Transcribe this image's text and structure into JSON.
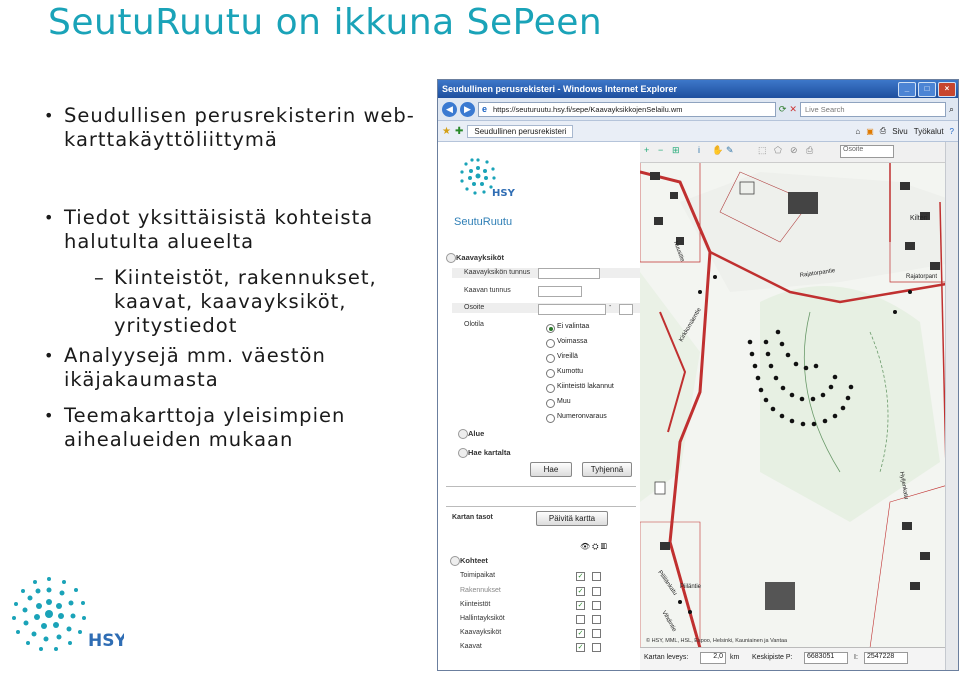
{
  "slide": {
    "title": "SeutuRuutu on ikkuna SePeen",
    "bullets": [
      "Seudullisen perusrekisterin web-karttakäyttöliittymä",
      "Tiedot yksittäisistä kohteista halutulta alueelta",
      "Analyysejä mm. väestön ikäjakaumasta",
      "Teemakarttoja yleisimpien aihealueiden mukaan"
    ],
    "subbullet": "Kiinteistöt, rakennukset, kaavat, kaavayksiköt, yritystiedot",
    "logo_text": "HSY"
  },
  "browser": {
    "title": "Seudullinen perusrekisteri - Windows Internet Explorer",
    "url": "https://seuturuutu.hsy.fi/sepe/KaavayksikkojenSelailu.wm",
    "search_placeholder": "Live Search",
    "tab_label": "Seudullinen perusrekisteri",
    "tools": [
      "Sivu",
      "Työkalut"
    ],
    "win_buttons": [
      "_",
      "□",
      "×"
    ]
  },
  "app": {
    "logo_text": "HSY",
    "product_name": "SeutuRuutu",
    "sections": {
      "kaavayksikot": "Kaavayksiköt",
      "alue": "Alue",
      "hae_kartalta": "Hae kartalta",
      "kartan_tasot": "Kartan tasot",
      "kohteet": "Kohteet"
    },
    "fields": {
      "kaavayksikon_tunnus": "Kaavayksikön tunnus",
      "kaavan_tunnus": "Kaavan tunnus",
      "osoite": "Osoite",
      "olotila": "Olotila",
      "osoite_sep": "-"
    },
    "olotila_options": [
      "Ei valintaa",
      "Voimassa",
      "Vireillä",
      "Kumottu",
      "Kiinteistö lakannut",
      "Muu",
      "Numeronvaraus"
    ],
    "olotila_selected": "Ei valintaa",
    "buttons": {
      "hae": "Hae",
      "tyhjenna": "Tyhjennä",
      "paivita_kartta": "Päivitä kartta"
    },
    "layers": [
      {
        "name": "Toimipaikat",
        "enabled": true,
        "checked": true
      },
      {
        "name": "Rakennukset",
        "enabled": false,
        "checked": true
      },
      {
        "name": "Kiinteistöt",
        "enabled": true,
        "checked": true
      },
      {
        "name": "Hallintayksiköt",
        "enabled": true,
        "checked": false
      },
      {
        "name": "Kaavayksiköt",
        "enabled": true,
        "checked": true
      },
      {
        "name": "Kaavat",
        "enabled": true,
        "checked": true
      }
    ]
  },
  "map": {
    "search_placeholder": "Osoite",
    "labels": [
      "Kilteri",
      "Rajatorpantie",
      "Rajatorpant",
      "Kuusitie",
      "Kirkkomäentie",
      "Hyljenkatu",
      "Piiläntie",
      "Pillilänkatu",
      "Vihdintie"
    ],
    "attribution": "© HSY, MML, HSL, Espoo, Helsinki, Kauniainen ja Vantaa",
    "scale_label": "Kartan leveys:",
    "scale_value": "2,0",
    "scale_unit": "km",
    "center_label": "Keskipiste P:",
    "center_p": "6683051",
    "center_i_label": "I:",
    "center_i": "2547228"
  }
}
